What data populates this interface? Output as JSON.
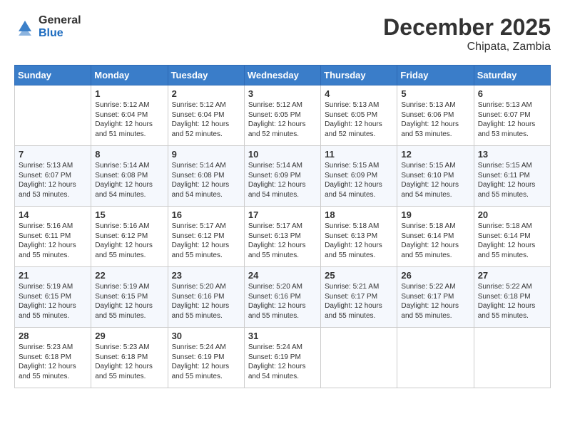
{
  "header": {
    "logo_general": "General",
    "logo_blue": "Blue",
    "month_year": "December 2025",
    "location": "Chipata, Zambia"
  },
  "columns": [
    "Sunday",
    "Monday",
    "Tuesday",
    "Wednesday",
    "Thursday",
    "Friday",
    "Saturday"
  ],
  "weeks": [
    [
      {
        "day": "",
        "sunrise": "",
        "sunset": "",
        "daylight": ""
      },
      {
        "day": "1",
        "sunrise": "Sunrise: 5:12 AM",
        "sunset": "Sunset: 6:04 PM",
        "daylight": "Daylight: 12 hours and 51 minutes."
      },
      {
        "day": "2",
        "sunrise": "Sunrise: 5:12 AM",
        "sunset": "Sunset: 6:04 PM",
        "daylight": "Daylight: 12 hours and 52 minutes."
      },
      {
        "day": "3",
        "sunrise": "Sunrise: 5:12 AM",
        "sunset": "Sunset: 6:05 PM",
        "daylight": "Daylight: 12 hours and 52 minutes."
      },
      {
        "day": "4",
        "sunrise": "Sunrise: 5:13 AM",
        "sunset": "Sunset: 6:05 PM",
        "daylight": "Daylight: 12 hours and 52 minutes."
      },
      {
        "day": "5",
        "sunrise": "Sunrise: 5:13 AM",
        "sunset": "Sunset: 6:06 PM",
        "daylight": "Daylight: 12 hours and 53 minutes."
      },
      {
        "day": "6",
        "sunrise": "Sunrise: 5:13 AM",
        "sunset": "Sunset: 6:07 PM",
        "daylight": "Daylight: 12 hours and 53 minutes."
      }
    ],
    [
      {
        "day": "7",
        "sunrise": "Sunrise: 5:13 AM",
        "sunset": "Sunset: 6:07 PM",
        "daylight": "Daylight: 12 hours and 53 minutes."
      },
      {
        "day": "8",
        "sunrise": "Sunrise: 5:14 AM",
        "sunset": "Sunset: 6:08 PM",
        "daylight": "Daylight: 12 hours and 54 minutes."
      },
      {
        "day": "9",
        "sunrise": "Sunrise: 5:14 AM",
        "sunset": "Sunset: 6:08 PM",
        "daylight": "Daylight: 12 hours and 54 minutes."
      },
      {
        "day": "10",
        "sunrise": "Sunrise: 5:14 AM",
        "sunset": "Sunset: 6:09 PM",
        "daylight": "Daylight: 12 hours and 54 minutes."
      },
      {
        "day": "11",
        "sunrise": "Sunrise: 5:15 AM",
        "sunset": "Sunset: 6:09 PM",
        "daylight": "Daylight: 12 hours and 54 minutes."
      },
      {
        "day": "12",
        "sunrise": "Sunrise: 5:15 AM",
        "sunset": "Sunset: 6:10 PM",
        "daylight": "Daylight: 12 hours and 54 minutes."
      },
      {
        "day": "13",
        "sunrise": "Sunrise: 5:15 AM",
        "sunset": "Sunset: 6:11 PM",
        "daylight": "Daylight: 12 hours and 55 minutes."
      }
    ],
    [
      {
        "day": "14",
        "sunrise": "Sunrise: 5:16 AM",
        "sunset": "Sunset: 6:11 PM",
        "daylight": "Daylight: 12 hours and 55 minutes."
      },
      {
        "day": "15",
        "sunrise": "Sunrise: 5:16 AM",
        "sunset": "Sunset: 6:12 PM",
        "daylight": "Daylight: 12 hours and 55 minutes."
      },
      {
        "day": "16",
        "sunrise": "Sunrise: 5:17 AM",
        "sunset": "Sunset: 6:12 PM",
        "daylight": "Daylight: 12 hours and 55 minutes."
      },
      {
        "day": "17",
        "sunrise": "Sunrise: 5:17 AM",
        "sunset": "Sunset: 6:13 PM",
        "daylight": "Daylight: 12 hours and 55 minutes."
      },
      {
        "day": "18",
        "sunrise": "Sunrise: 5:18 AM",
        "sunset": "Sunset: 6:13 PM",
        "daylight": "Daylight: 12 hours and 55 minutes."
      },
      {
        "day": "19",
        "sunrise": "Sunrise: 5:18 AM",
        "sunset": "Sunset: 6:14 PM",
        "daylight": "Daylight: 12 hours and 55 minutes."
      },
      {
        "day": "20",
        "sunrise": "Sunrise: 5:18 AM",
        "sunset": "Sunset: 6:14 PM",
        "daylight": "Daylight: 12 hours and 55 minutes."
      }
    ],
    [
      {
        "day": "21",
        "sunrise": "Sunrise: 5:19 AM",
        "sunset": "Sunset: 6:15 PM",
        "daylight": "Daylight: 12 hours and 55 minutes."
      },
      {
        "day": "22",
        "sunrise": "Sunrise: 5:19 AM",
        "sunset": "Sunset: 6:15 PM",
        "daylight": "Daylight: 12 hours and 55 minutes."
      },
      {
        "day": "23",
        "sunrise": "Sunrise: 5:20 AM",
        "sunset": "Sunset: 6:16 PM",
        "daylight": "Daylight: 12 hours and 55 minutes."
      },
      {
        "day": "24",
        "sunrise": "Sunrise: 5:20 AM",
        "sunset": "Sunset: 6:16 PM",
        "daylight": "Daylight: 12 hours and 55 minutes."
      },
      {
        "day": "25",
        "sunrise": "Sunrise: 5:21 AM",
        "sunset": "Sunset: 6:17 PM",
        "daylight": "Daylight: 12 hours and 55 minutes."
      },
      {
        "day": "26",
        "sunrise": "Sunrise: 5:22 AM",
        "sunset": "Sunset: 6:17 PM",
        "daylight": "Daylight: 12 hours and 55 minutes."
      },
      {
        "day": "27",
        "sunrise": "Sunrise: 5:22 AM",
        "sunset": "Sunset: 6:18 PM",
        "daylight": "Daylight: 12 hours and 55 minutes."
      }
    ],
    [
      {
        "day": "28",
        "sunrise": "Sunrise: 5:23 AM",
        "sunset": "Sunset: 6:18 PM",
        "daylight": "Daylight: 12 hours and 55 minutes."
      },
      {
        "day": "29",
        "sunrise": "Sunrise: 5:23 AM",
        "sunset": "Sunset: 6:18 PM",
        "daylight": "Daylight: 12 hours and 55 minutes."
      },
      {
        "day": "30",
        "sunrise": "Sunrise: 5:24 AM",
        "sunset": "Sunset: 6:19 PM",
        "daylight": "Daylight: 12 hours and 55 minutes."
      },
      {
        "day": "31",
        "sunrise": "Sunrise: 5:24 AM",
        "sunset": "Sunset: 6:19 PM",
        "daylight": "Daylight: 12 hours and 54 minutes."
      },
      {
        "day": "",
        "sunrise": "",
        "sunset": "",
        "daylight": ""
      },
      {
        "day": "",
        "sunrise": "",
        "sunset": "",
        "daylight": ""
      },
      {
        "day": "",
        "sunrise": "",
        "sunset": "",
        "daylight": ""
      }
    ]
  ]
}
